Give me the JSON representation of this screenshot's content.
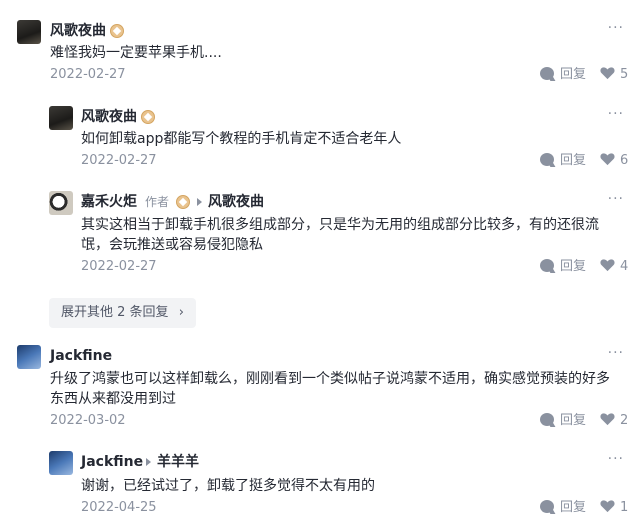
{
  "comments": [
    {
      "user": "风歌夜曲",
      "text": "难怪我妈一定要苹果手机....",
      "date": "2022-02-27",
      "reply_label": "回复",
      "likes": "5"
    }
  ],
  "replies": [
    {
      "user": "风歌夜曲",
      "text": "如何卸载app都能写个教程的手机肯定不适合老年人",
      "date": "2022-02-27",
      "reply_label": "回复",
      "likes": "6"
    },
    {
      "user": "嘉禾火炬",
      "author_tag": "作者",
      "reply_to": "风歌夜曲",
      "text_line1": "其实这相当于卸载手机很多组成部分，只是华为无用的组成部分比较多，有的还很流",
      "text_line2": "氓，会玩推送或容易侵犯隐私",
      "date": "2022-02-27",
      "reply_label": "回复",
      "likes": "4"
    }
  ],
  "expand_label": "展开其他 2 条回复",
  "second": {
    "user": "Jackfine",
    "text_line1": "升级了鸿蒙也可以这样卸载么，刚刚看到一个类似帖子说鸿蒙不适用，确实感觉预装的好多",
    "text_line2": "东西从来都没用到过",
    "date": "2022-03-02",
    "reply_label": "回复",
    "likes": "2"
  },
  "second_reply": {
    "user": "Jackfine",
    "reply_to": "羊羊羊",
    "text": "谢谢，已经试过了，卸载了挺多觉得不太有用的",
    "date": "2022-04-25",
    "reply_label": "回复",
    "likes": "1"
  },
  "more_glyph": "···",
  "colors": {
    "muted": "#8a919f",
    "text": "#252933",
    "expand_bg": "#f2f3f5",
    "badge": "#e9c38e"
  }
}
